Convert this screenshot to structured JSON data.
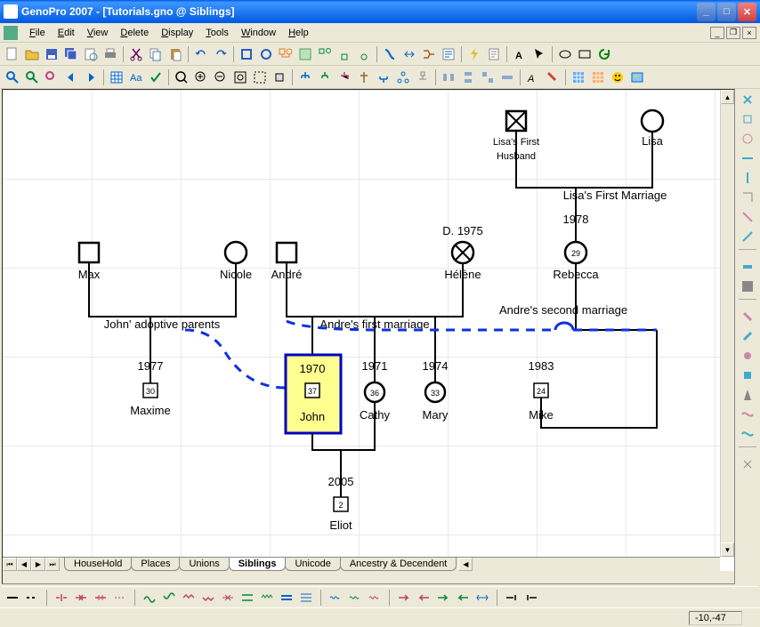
{
  "window": {
    "title": "GenoPro 2007 - [Tutorials.gno @ Siblings]"
  },
  "menu": {
    "items": [
      "File",
      "Edit",
      "View",
      "Delete",
      "Display",
      "Tools",
      "Window",
      "Help"
    ]
  },
  "tabs": {
    "items": [
      "HouseHold",
      "Places",
      "Unions",
      "Siblings",
      "Unicode",
      "Ancestry & Decendent"
    ],
    "active": "Siblings"
  },
  "status": {
    "coords": "-10,-47"
  },
  "people": {
    "lisa_first_husband": {
      "name": "Lisa's First\nHusband"
    },
    "lisa": {
      "name": "Lisa"
    },
    "max": {
      "name": "Max"
    },
    "nicole": {
      "name": "Nicole"
    },
    "andre": {
      "name": "André"
    },
    "helene": {
      "name": "Hélène",
      "death": "D. 1975"
    },
    "rebecca": {
      "name": "Rebecca",
      "age": "29"
    },
    "maxime": {
      "name": "Maxime",
      "year": "1977",
      "age": "30"
    },
    "john": {
      "name": "John",
      "year": "1970",
      "age": "37"
    },
    "cathy": {
      "name": "Cathy",
      "year": "1971",
      "age": "36"
    },
    "mary": {
      "name": "Mary",
      "year": "1974",
      "age": "33"
    },
    "mike": {
      "name": "Mike",
      "year": "1983",
      "age": "24"
    },
    "eliot": {
      "name": "Eliot",
      "year": "2005",
      "age": "2"
    }
  },
  "relationships": {
    "lisa_first_marriage": {
      "label": "Lisa's First Marriage",
      "year": "1978"
    },
    "john_adoptive_parents": {
      "label": "John' adoptive parents"
    },
    "andre_first_marriage": {
      "label": "Andre's first marriage"
    },
    "andre_second_marriage": {
      "label": "Andre's second marriage"
    }
  }
}
